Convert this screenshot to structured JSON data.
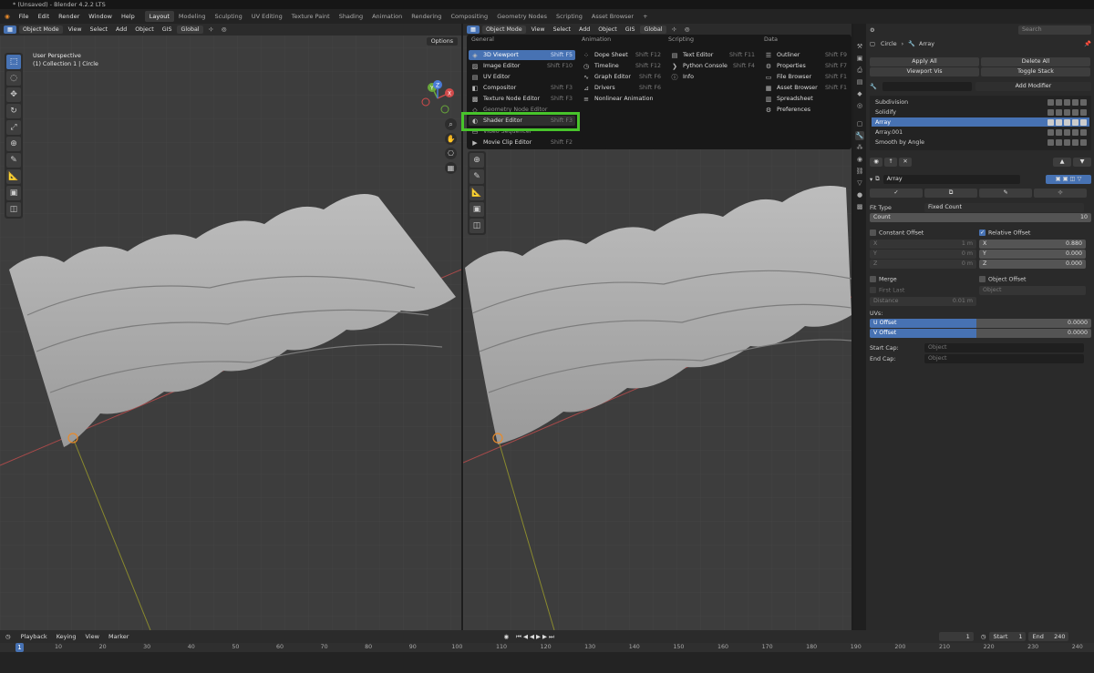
{
  "window": {
    "title": "* (Unsaved) - Blender 4.2.2 LTS"
  },
  "menubar": {
    "menus": [
      "File",
      "Edit",
      "Render",
      "Window",
      "Help"
    ],
    "workspaces": [
      "Layout",
      "Modeling",
      "Sculpting",
      "UV Editing",
      "Texture Paint",
      "Shading",
      "Animation",
      "Rendering",
      "Compositing",
      "Geometry Nodes",
      "Scripting",
      "Asset Browser"
    ],
    "active_workspace": "Layout",
    "add_tab": "+"
  },
  "viewport_left": {
    "mode": "Object Mode",
    "menus": [
      "View",
      "Select",
      "Add",
      "Object"
    ],
    "gis": "GIS",
    "orientation": "Global",
    "options": "Options",
    "info_line1": "User Perspective",
    "info_line2": "(1) Collection 1 | Circle",
    "gizmo": {
      "x": "X",
      "y": "Y",
      "z": "Z"
    }
  },
  "viewport_right": {
    "mode": "Object Mode",
    "menus": [
      "View",
      "Select",
      "Add",
      "Object"
    ],
    "gis": "GIS",
    "orientation": "Global"
  },
  "editor_menu": {
    "headers": [
      "General",
      "Animation",
      "Scripting",
      "Data"
    ],
    "general": [
      {
        "label": "3D Viewport",
        "shortcut": "Shift F5",
        "icon": "3d-viewport-icon"
      },
      {
        "label": "Image Editor",
        "shortcut": "Shift F10",
        "icon": "image-editor-icon"
      },
      {
        "label": "UV Editor",
        "shortcut": "Shift F10",
        "icon": "uv-editor-icon"
      },
      {
        "label": "Compositor",
        "shortcut": "Shift F3",
        "icon": "compositor-icon"
      },
      {
        "label": "Texture Node Editor",
        "shortcut": "Shift F3",
        "icon": "texture-node-icon"
      },
      {
        "label": "Geometry Node Editor",
        "shortcut": "Shift F3",
        "icon": "geometry-node-icon"
      },
      {
        "label": "Shader Editor",
        "shortcut": "Shift F3",
        "icon": "shader-editor-icon"
      },
      {
        "label": "Video Sequencer",
        "shortcut": "Shift F8",
        "icon": "video-sequencer-icon"
      },
      {
        "label": "Movie Clip Editor",
        "shortcut": "Shift F2",
        "icon": "movie-clip-icon"
      }
    ],
    "animation": [
      {
        "label": "Dope Sheet",
        "shortcut": "Shift F12"
      },
      {
        "label": "Timeline",
        "shortcut": "Shift F12"
      },
      {
        "label": "Graph Editor",
        "shortcut": "Shift F6"
      },
      {
        "label": "Drivers",
        "shortcut": "Shift F6"
      },
      {
        "label": "Nonlinear Animation",
        "shortcut": ""
      }
    ],
    "scripting": [
      {
        "label": "Text Editor",
        "shortcut": "Shift F11"
      },
      {
        "label": "Python Console",
        "shortcut": "Shift F4"
      },
      {
        "label": "Info",
        "shortcut": ""
      }
    ],
    "data": [
      {
        "label": "Outliner",
        "shortcut": "Shift F9"
      },
      {
        "label": "Properties",
        "shortcut": "Shift F7"
      },
      {
        "label": "File Browser",
        "shortcut": "Shift F1"
      },
      {
        "label": "Asset Browser",
        "shortcut": "Shift F1"
      },
      {
        "label": "Spreadsheet",
        "shortcut": ""
      },
      {
        "label": "Preferences",
        "shortcut": ""
      }
    ]
  },
  "properties": {
    "search_placeholder": "Search",
    "breadcrumb": {
      "object": "Circle",
      "modifier": "Array"
    },
    "apply_all": "Apply All",
    "delete_all": "Delete All",
    "viewport_vis": "Viewport Vis",
    "toggle_stack": "Toggle Stack",
    "add_modifier": "Add Modifier",
    "modifiers": [
      "Subdivision",
      "Solidify",
      "Array",
      "Array.001",
      "Smooth by Angle"
    ],
    "selected_modifier": "Array",
    "array": {
      "name": "Array",
      "fit_type_label": "Fit Type",
      "fit_type_value": "Fixed Count",
      "count_label": "Count",
      "count_value": "10",
      "constant_offset": "Constant Offset",
      "relative_offset": "Relative Offset",
      "const": {
        "x_label": "X",
        "x": "1 m",
        "y_label": "Y",
        "y": "0 m",
        "z_label": "Z",
        "z": "0 m"
      },
      "rel": {
        "x_label": "X",
        "x": "0.880",
        "y_label": "Y",
        "y": "0.000",
        "z_label": "Z",
        "z": "0.000"
      },
      "merge": "Merge",
      "object_offset": "Object Offset",
      "first_last": "First Last",
      "object_placeholder": "Object",
      "distance_label": "Distance",
      "distance_value": "0.01 m",
      "uvs": "UVs:",
      "u_offset_label": "U Offset",
      "u_offset": "0.0000",
      "v_offset_label": "V Offset",
      "v_offset": "0.0000",
      "start_cap": "Start Cap:",
      "end_cap": "End Cap:",
      "cap_placeholder": "Object"
    }
  },
  "timeline": {
    "menus": [
      "Playback",
      "Keying",
      "View",
      "Marker"
    ],
    "current_frame": "1",
    "start_label": "Start",
    "start": "1",
    "end_label": "End",
    "end": "240",
    "ticks": [
      "1",
      "10",
      "20",
      "30",
      "40",
      "50",
      "60",
      "70",
      "80",
      "90",
      "100",
      "110",
      "120",
      "130",
      "140",
      "150",
      "160",
      "170",
      "180",
      "190",
      "200",
      "210",
      "220",
      "230",
      "240"
    ]
  },
  "colors": {
    "accent": "#4772b3",
    "highlight": "#48c42b",
    "background": "#3d3d3d"
  }
}
